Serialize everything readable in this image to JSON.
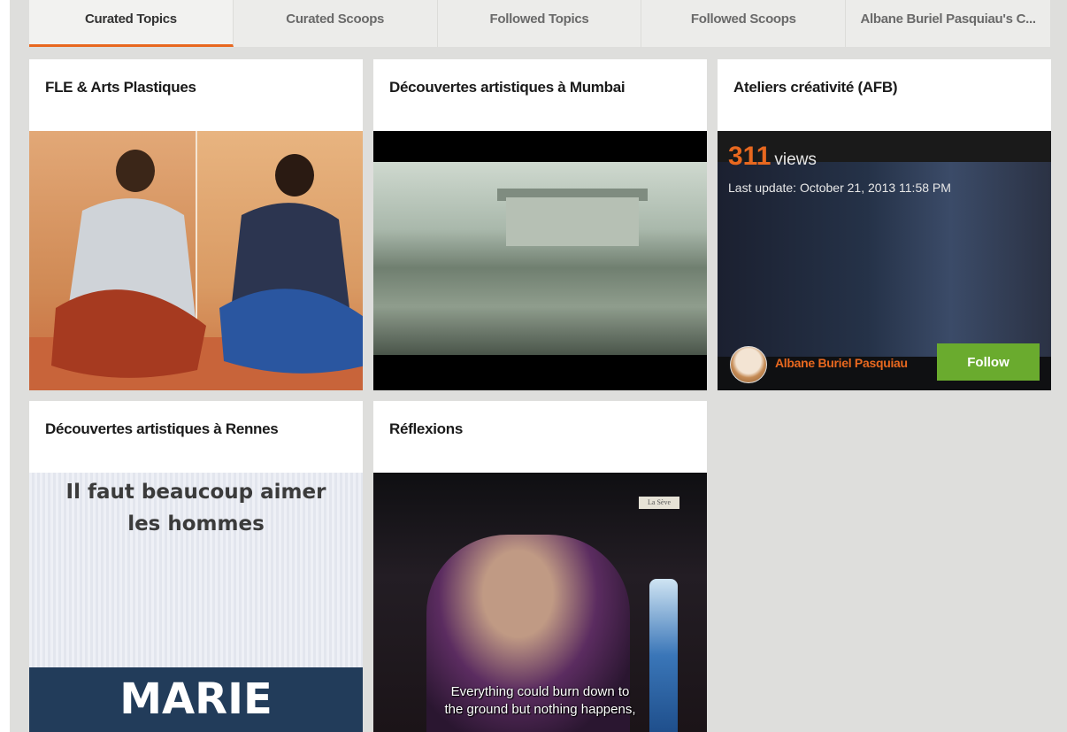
{
  "tabs": [
    {
      "label": "Curated Topics",
      "active": true
    },
    {
      "label": "Curated Scoops",
      "active": false
    },
    {
      "label": "Followed Topics",
      "active": false
    },
    {
      "label": "Followed Scoops",
      "active": false
    },
    {
      "label": "Albane Buriel Pasquiau's C...",
      "active": false
    }
  ],
  "cards": [
    {
      "title": "FLE & Arts Plastiques"
    },
    {
      "title": "Découvertes artistiques à Mumbai"
    },
    {
      "title": "Ateliers créativité (AFB)",
      "views_count": "311",
      "views_label": "views",
      "last_update": "Last update: October 21, 2013 11:58 PM",
      "author": "Albane Buriel Pasquiau",
      "follow_label": "Follow"
    },
    {
      "title": "Découvertes artistiques à Rennes",
      "cover_line1": "Il faut beaucoup aimer",
      "cover_line2": "les hommes",
      "cover_name": "MARIE"
    },
    {
      "title": "Réflexions",
      "logo_text": "La Sève",
      "subtitle_line1": "Everything could burn down to",
      "subtitle_line2": "the ground but nothing happens,"
    }
  ],
  "colors": {
    "accent": "#e8681f",
    "follow_button": "#6aab2e",
    "page_bg": "#dededc"
  }
}
